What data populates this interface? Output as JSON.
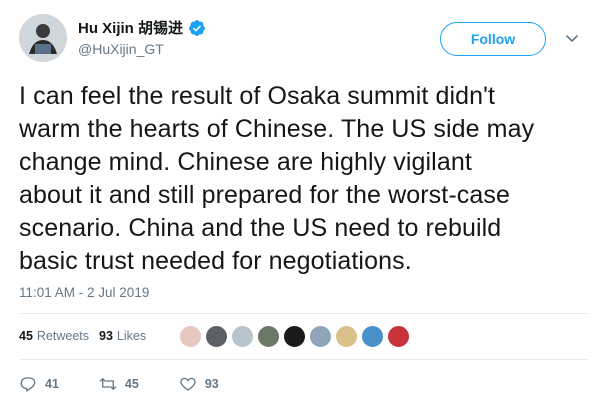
{
  "author": {
    "display_name": "Hu Xijin 胡锡进",
    "handle": "@HuXijin_GT",
    "verified": true
  },
  "follow_label": "Follow",
  "text_lines": [
    "I can feel the result of Osaka summit didn't",
    "warm the hearts of Chinese. The US side may",
    "change mind. Chinese are highly vigilant",
    "about it and still prepared for the worst-case",
    "scenario. China and the US need to rebuild",
    "basic trust needed for negotiations."
  ],
  "timestamp": "11:01 AM - 2 Jul 2019",
  "stats": {
    "retweets_count": "45",
    "retweets_label": "Retweets",
    "likes_count": "93",
    "likes_label": "Likes"
  },
  "likers": [
    {
      "color": "#e8c6c0"
    },
    {
      "color": "#5b5f66"
    },
    {
      "color": "#b8c4cc"
    },
    {
      "color": "#6a7866"
    },
    {
      "color": "#1a1a1a"
    },
    {
      "color": "#8fa4b8"
    },
    {
      "color": "#d8c28a"
    },
    {
      "color": "#4a90c8"
    },
    {
      "color": "#c8323a"
    }
  ],
  "actions": {
    "replies": "41",
    "retweets": "45",
    "likes": "93"
  },
  "colors": {
    "accent": "#1da1f2",
    "text": "#14171a",
    "muted": "#657786"
  }
}
